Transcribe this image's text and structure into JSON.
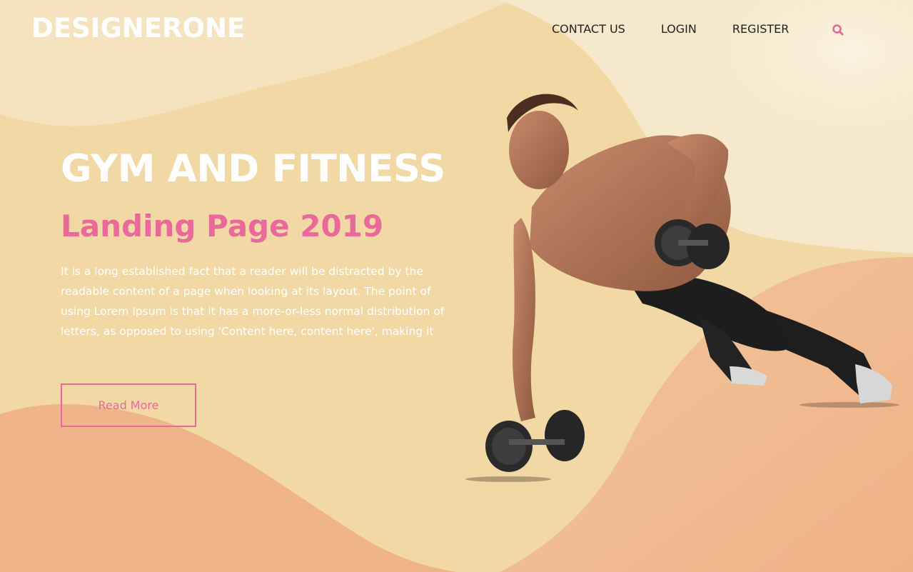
{
  "brand": {
    "logo": "DESIGNERONE"
  },
  "nav": {
    "items": [
      {
        "label": "CONTACT US"
      },
      {
        "label": "LOGIN"
      },
      {
        "label": "REGISTER"
      }
    ],
    "search_icon": "search-icon"
  },
  "hero": {
    "title": "GYM AND FITNESS",
    "subtitle": "Landing Page 2019",
    "body": "It is a long established fact that a reader will be distracted by the readable content of a page when looking at its layout. The point of using Lorem Ipsum is that it has a more-or-less normal distribution of letters, as opposed to using 'Content here, content here', making it",
    "cta_label": "Read More",
    "image_subject": "athlete-doing-dumbbell-pushup"
  },
  "colors": {
    "accent": "#e8699a",
    "background": "#f2d9a6",
    "wave_light": "#f5e6c8",
    "wave_peach": "#f0b58c"
  }
}
